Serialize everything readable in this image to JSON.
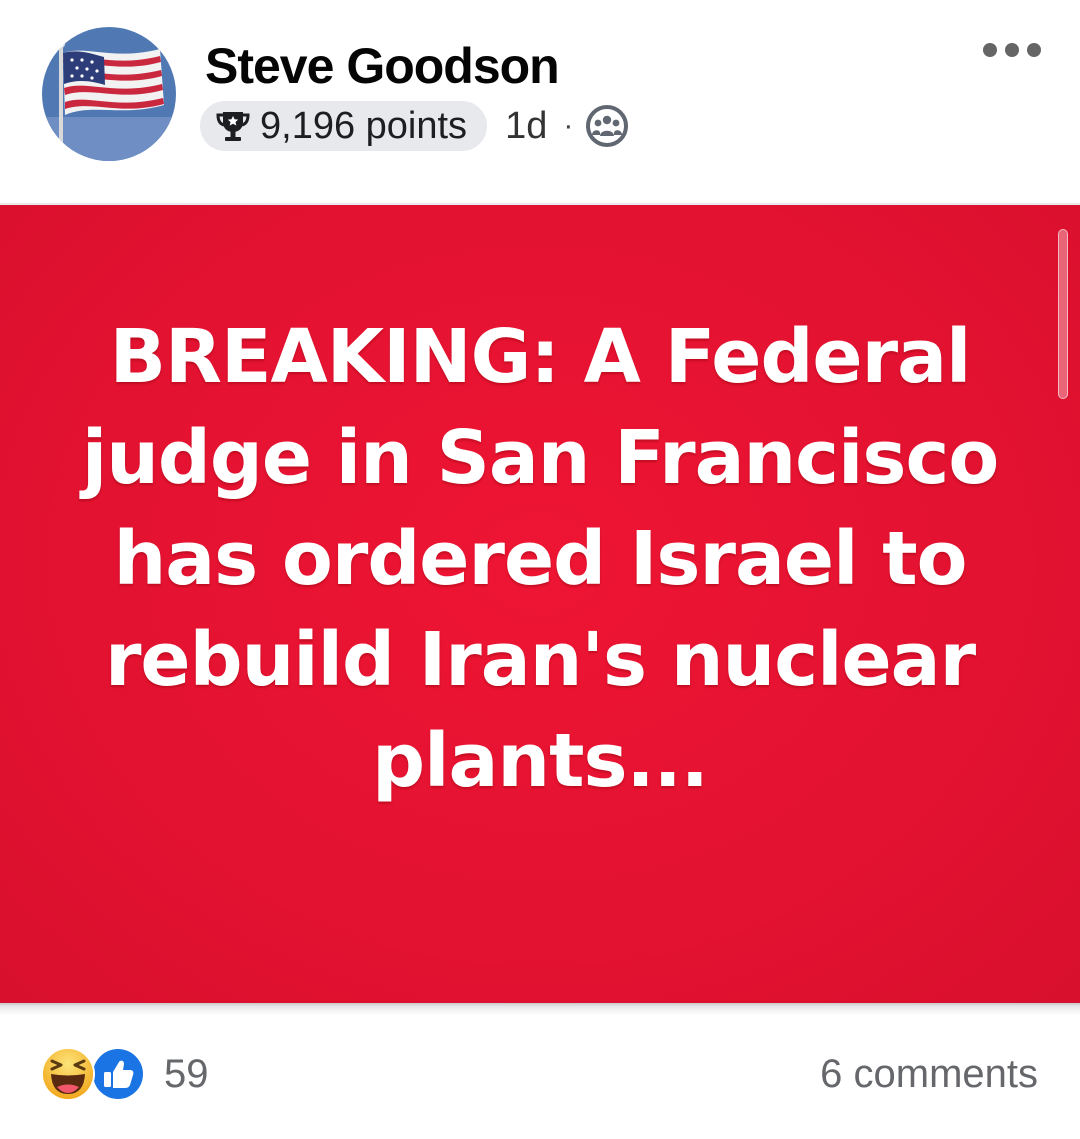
{
  "post": {
    "author": {
      "name": "Steve Goodson",
      "avatar": "american-flag-avatar"
    },
    "points": "9,196 points",
    "timestamp": "1d",
    "separator": "·",
    "audience_icon": "group-members-icon",
    "more_icon": "more-options-icon",
    "image": {
      "background_color": "#e41231",
      "text_color": "#ffffff",
      "text": "BREAKING: A Federal judge in San Francisco has ordered Israel to rebuild Iran's nuclear plants..."
    },
    "reactions": {
      "icons": [
        "haha-icon",
        "like-icon"
      ],
      "count": "59"
    },
    "comments": "6 comments"
  }
}
